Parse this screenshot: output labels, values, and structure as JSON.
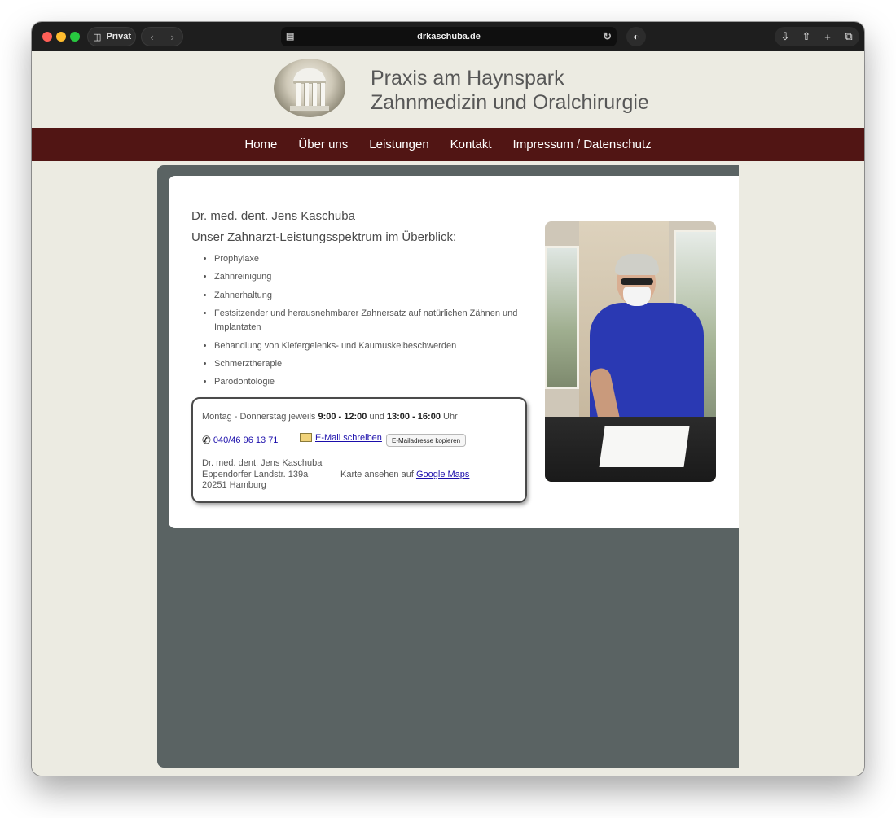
{
  "browser": {
    "private_label": "Privat",
    "url": "drkaschuba.de"
  },
  "site": {
    "title_line1": "Praxis am Haynspark",
    "title_line2": "Zahnmedizin und Oralchirurgie"
  },
  "nav": {
    "items": [
      {
        "label": "Home"
      },
      {
        "label": "Über uns"
      },
      {
        "label": "Leistungen"
      },
      {
        "label": "Kontakt"
      },
      {
        "label": "Impressum / Datenschutz"
      }
    ]
  },
  "main": {
    "doctor_name": "Dr. med. dent. Jens Kaschuba",
    "subtitle": "Unser Zahnarzt-Leistungsspektrum im Überblick:",
    "services": [
      "Prophylaxe",
      "Zahnreinigung",
      "Zahnerhaltung",
      "Festsitzender und herausnehmbarer Zahnersatz auf natürlichen Zähnen und Implantaten",
      "Behandlung von Kiefergelenks- und Kaumuskelbeschwerden",
      "Schmerztherapie",
      "Parodontologie"
    ]
  },
  "info": {
    "hours_prefix": "Montag - Donnerstag jeweils",
    "hours_1": "9:00 - 12:00",
    "hours_and": "und",
    "hours_2": "13:00 - 16:00",
    "hours_suffix": "Uhr",
    "phone": "040/46 96 13 71",
    "email_link": "E-Mail schreiben",
    "copy_button": "E-Mailadresse kopieren",
    "address_name": "Dr. med. dent. Jens Kaschuba",
    "address_street": "Eppendorfer Landstr. 139a",
    "address_city": "20251 Hamburg",
    "maps_prefix": "Karte ansehen auf",
    "maps_link": "Google Maps"
  },
  "colors": {
    "nav_bg": "#511514",
    "page_bg": "#ecebe2",
    "content_bg": "#5a6363",
    "link": "#1a0dab"
  }
}
